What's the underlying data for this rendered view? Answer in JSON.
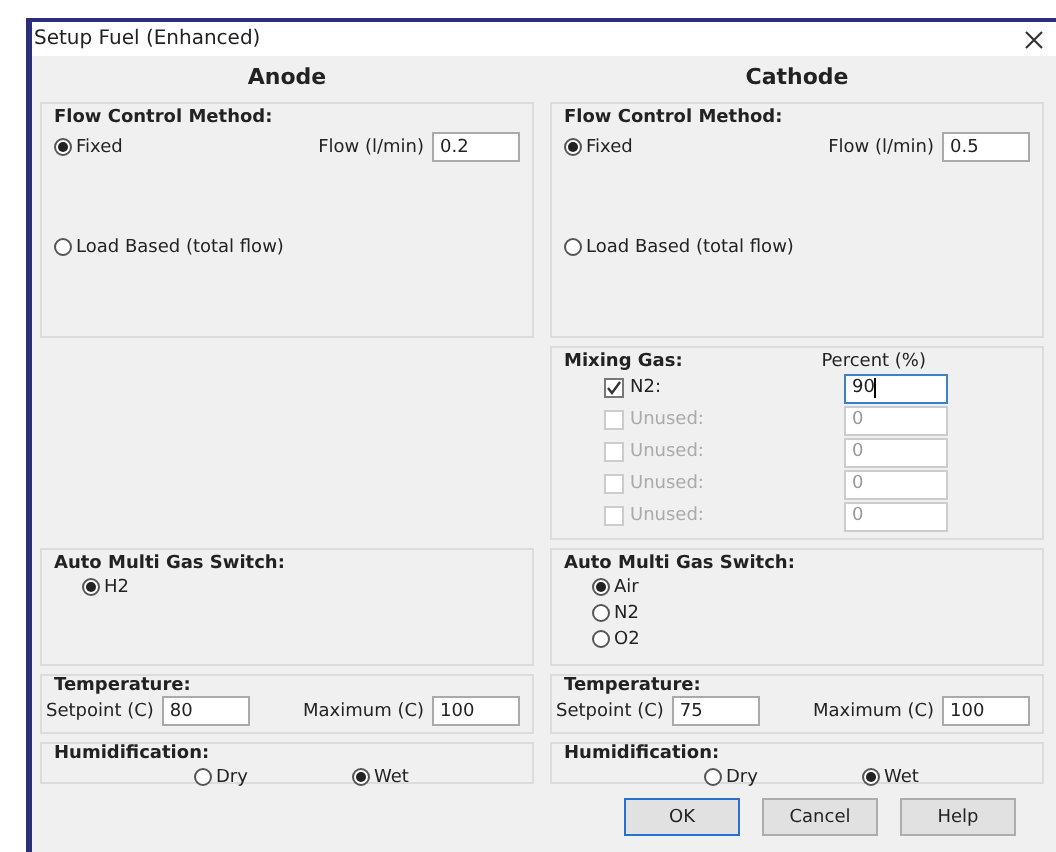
{
  "window": {
    "title": "Setup Fuel (Enhanced)"
  },
  "panels": [
    {
      "heading": "Anode",
      "flow_control": {
        "title": "Flow Control Method:",
        "options": [
          {
            "label": "Fixed",
            "selected": true
          },
          {
            "label": "Load Based (total flow)",
            "selected": false
          }
        ],
        "flow_label": "Flow (l/min)",
        "flow_value": "0.2"
      },
      "gas_switch": {
        "title": "Auto Multi Gas Switch:",
        "options": [
          {
            "label": "H2",
            "selected": true
          }
        ]
      },
      "temperature": {
        "title": "Temperature:",
        "setpoint_label": "Setpoint (C)",
        "setpoint": "80",
        "maximum_label": "Maximum (C)",
        "maximum": "100"
      },
      "humidification": {
        "title": "Humidification:",
        "options": [
          {
            "label": "Dry",
            "selected": false
          },
          {
            "label": "Wet",
            "selected": true
          }
        ]
      }
    },
    {
      "heading": "Cathode",
      "flow_control": {
        "title": "Flow Control Method:",
        "options": [
          {
            "label": "Fixed",
            "selected": true
          },
          {
            "label": "Load Based (total flow)",
            "selected": false
          }
        ],
        "flow_label": "Flow (l/min)",
        "flow_value": "0.5"
      },
      "mixing_gas": {
        "title": "Mixing Gas:",
        "column_header": "Percent (%)",
        "rows": [
          {
            "label": "N2:",
            "checked": true,
            "disabled": false,
            "focused": true,
            "value": "90"
          },
          {
            "label": "Unused:",
            "checked": false,
            "disabled": true,
            "focused": false,
            "value": "0"
          },
          {
            "label": "Unused:",
            "checked": false,
            "disabled": true,
            "focused": false,
            "value": "0"
          },
          {
            "label": "Unused:",
            "checked": false,
            "disabled": true,
            "focused": false,
            "value": "0"
          },
          {
            "label": "Unused:",
            "checked": false,
            "disabled": true,
            "focused": false,
            "value": "0"
          }
        ]
      },
      "gas_switch": {
        "title": "Auto Multi Gas Switch:",
        "options": [
          {
            "label": "Air",
            "selected": true
          },
          {
            "label": "N2",
            "selected": false
          },
          {
            "label": "O2",
            "selected": false
          }
        ]
      },
      "temperature": {
        "title": "Temperature:",
        "setpoint_label": "Setpoint (C)",
        "setpoint": "75",
        "maximum_label": "Maximum (C)",
        "maximum": "100"
      },
      "humidification": {
        "title": "Humidification:",
        "options": [
          {
            "label": "Dry",
            "selected": false
          },
          {
            "label": "Wet",
            "selected": true
          }
        ]
      }
    }
  ],
  "buttons": [
    {
      "label": "OK",
      "default": true
    },
    {
      "label": "Cancel",
      "default": false
    },
    {
      "label": "Help",
      "default": false
    }
  ]
}
